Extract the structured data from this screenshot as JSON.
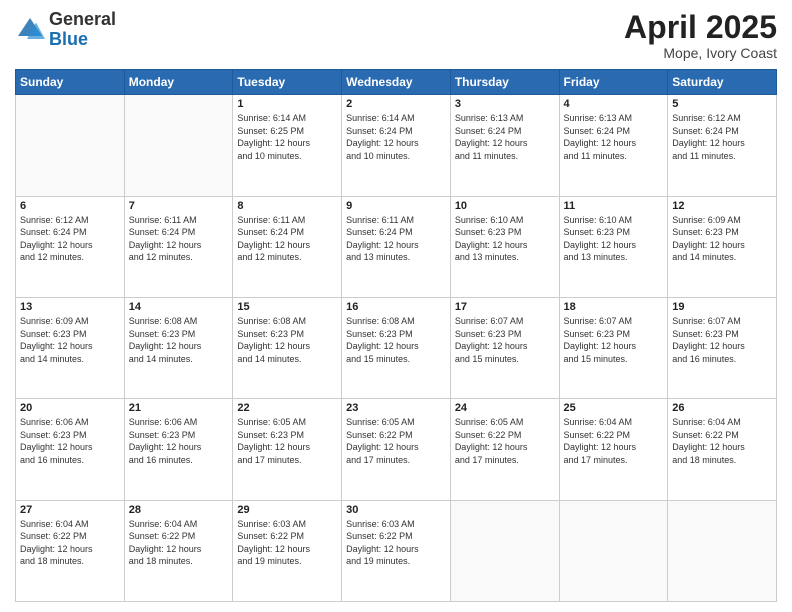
{
  "header": {
    "logo_general": "General",
    "logo_blue": "Blue",
    "month": "April 2025",
    "location": "Mope, Ivory Coast"
  },
  "days_of_week": [
    "Sunday",
    "Monday",
    "Tuesday",
    "Wednesday",
    "Thursday",
    "Friday",
    "Saturday"
  ],
  "weeks": [
    [
      {
        "num": "",
        "detail": ""
      },
      {
        "num": "",
        "detail": ""
      },
      {
        "num": "1",
        "detail": "Sunrise: 6:14 AM\nSunset: 6:25 PM\nDaylight: 12 hours\nand 10 minutes."
      },
      {
        "num": "2",
        "detail": "Sunrise: 6:14 AM\nSunset: 6:24 PM\nDaylight: 12 hours\nand 10 minutes."
      },
      {
        "num": "3",
        "detail": "Sunrise: 6:13 AM\nSunset: 6:24 PM\nDaylight: 12 hours\nand 11 minutes."
      },
      {
        "num": "4",
        "detail": "Sunrise: 6:13 AM\nSunset: 6:24 PM\nDaylight: 12 hours\nand 11 minutes."
      },
      {
        "num": "5",
        "detail": "Sunrise: 6:12 AM\nSunset: 6:24 PM\nDaylight: 12 hours\nand 11 minutes."
      }
    ],
    [
      {
        "num": "6",
        "detail": "Sunrise: 6:12 AM\nSunset: 6:24 PM\nDaylight: 12 hours\nand 12 minutes."
      },
      {
        "num": "7",
        "detail": "Sunrise: 6:11 AM\nSunset: 6:24 PM\nDaylight: 12 hours\nand 12 minutes."
      },
      {
        "num": "8",
        "detail": "Sunrise: 6:11 AM\nSunset: 6:24 PM\nDaylight: 12 hours\nand 12 minutes."
      },
      {
        "num": "9",
        "detail": "Sunrise: 6:11 AM\nSunset: 6:24 PM\nDaylight: 12 hours\nand 13 minutes."
      },
      {
        "num": "10",
        "detail": "Sunrise: 6:10 AM\nSunset: 6:23 PM\nDaylight: 12 hours\nand 13 minutes."
      },
      {
        "num": "11",
        "detail": "Sunrise: 6:10 AM\nSunset: 6:23 PM\nDaylight: 12 hours\nand 13 minutes."
      },
      {
        "num": "12",
        "detail": "Sunrise: 6:09 AM\nSunset: 6:23 PM\nDaylight: 12 hours\nand 14 minutes."
      }
    ],
    [
      {
        "num": "13",
        "detail": "Sunrise: 6:09 AM\nSunset: 6:23 PM\nDaylight: 12 hours\nand 14 minutes."
      },
      {
        "num": "14",
        "detail": "Sunrise: 6:08 AM\nSunset: 6:23 PM\nDaylight: 12 hours\nand 14 minutes."
      },
      {
        "num": "15",
        "detail": "Sunrise: 6:08 AM\nSunset: 6:23 PM\nDaylight: 12 hours\nand 14 minutes."
      },
      {
        "num": "16",
        "detail": "Sunrise: 6:08 AM\nSunset: 6:23 PM\nDaylight: 12 hours\nand 15 minutes."
      },
      {
        "num": "17",
        "detail": "Sunrise: 6:07 AM\nSunset: 6:23 PM\nDaylight: 12 hours\nand 15 minutes."
      },
      {
        "num": "18",
        "detail": "Sunrise: 6:07 AM\nSunset: 6:23 PM\nDaylight: 12 hours\nand 15 minutes."
      },
      {
        "num": "19",
        "detail": "Sunrise: 6:07 AM\nSunset: 6:23 PM\nDaylight: 12 hours\nand 16 minutes."
      }
    ],
    [
      {
        "num": "20",
        "detail": "Sunrise: 6:06 AM\nSunset: 6:23 PM\nDaylight: 12 hours\nand 16 minutes."
      },
      {
        "num": "21",
        "detail": "Sunrise: 6:06 AM\nSunset: 6:23 PM\nDaylight: 12 hours\nand 16 minutes."
      },
      {
        "num": "22",
        "detail": "Sunrise: 6:05 AM\nSunset: 6:23 PM\nDaylight: 12 hours\nand 17 minutes."
      },
      {
        "num": "23",
        "detail": "Sunrise: 6:05 AM\nSunset: 6:22 PM\nDaylight: 12 hours\nand 17 minutes."
      },
      {
        "num": "24",
        "detail": "Sunrise: 6:05 AM\nSunset: 6:22 PM\nDaylight: 12 hours\nand 17 minutes."
      },
      {
        "num": "25",
        "detail": "Sunrise: 6:04 AM\nSunset: 6:22 PM\nDaylight: 12 hours\nand 17 minutes."
      },
      {
        "num": "26",
        "detail": "Sunrise: 6:04 AM\nSunset: 6:22 PM\nDaylight: 12 hours\nand 18 minutes."
      }
    ],
    [
      {
        "num": "27",
        "detail": "Sunrise: 6:04 AM\nSunset: 6:22 PM\nDaylight: 12 hours\nand 18 minutes."
      },
      {
        "num": "28",
        "detail": "Sunrise: 6:04 AM\nSunset: 6:22 PM\nDaylight: 12 hours\nand 18 minutes."
      },
      {
        "num": "29",
        "detail": "Sunrise: 6:03 AM\nSunset: 6:22 PM\nDaylight: 12 hours\nand 19 minutes."
      },
      {
        "num": "30",
        "detail": "Sunrise: 6:03 AM\nSunset: 6:22 PM\nDaylight: 12 hours\nand 19 minutes."
      },
      {
        "num": "",
        "detail": ""
      },
      {
        "num": "",
        "detail": ""
      },
      {
        "num": "",
        "detail": ""
      }
    ]
  ]
}
